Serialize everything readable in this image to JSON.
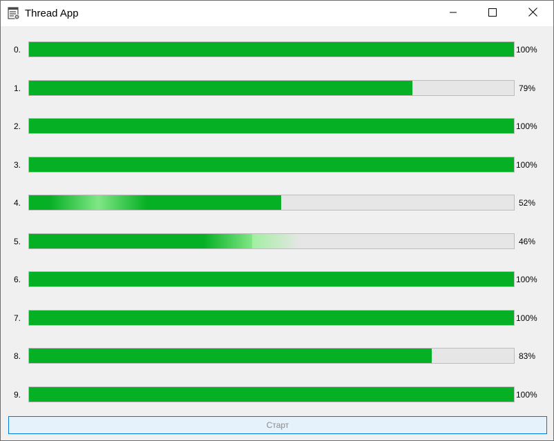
{
  "window": {
    "title": "Thread App"
  },
  "progress_rows": [
    {
      "label": "0.",
      "value": 100,
      "percent_text": "100%"
    },
    {
      "label": "1.",
      "value": 79,
      "percent_text": "79%"
    },
    {
      "label": "2.",
      "value": 100,
      "percent_text": "100%"
    },
    {
      "label": "3.",
      "value": 100,
      "percent_text": "100%"
    },
    {
      "label": "4.",
      "value": 52,
      "percent_text": "52%",
      "animating": true
    },
    {
      "label": "5.",
      "value": 46,
      "percent_text": "46%",
      "animating": true
    },
    {
      "label": "6.",
      "value": 100,
      "percent_text": "100%"
    },
    {
      "label": "7.",
      "value": 100,
      "percent_text": "100%"
    },
    {
      "label": "8.",
      "value": 83,
      "percent_text": "83%"
    },
    {
      "label": "9.",
      "value": 100,
      "percent_text": "100%"
    }
  ],
  "start_button": {
    "label": "Старт",
    "enabled": false
  },
  "colors": {
    "progress_fill": "#06b025",
    "progress_track": "#e6e6e6",
    "button_border": "#0078d7",
    "button_bg": "#e5f1fb"
  },
  "icons": {
    "app": "app-window-icon",
    "minimize": "minimize-icon",
    "maximize": "maximize-icon",
    "close": "close-icon"
  }
}
